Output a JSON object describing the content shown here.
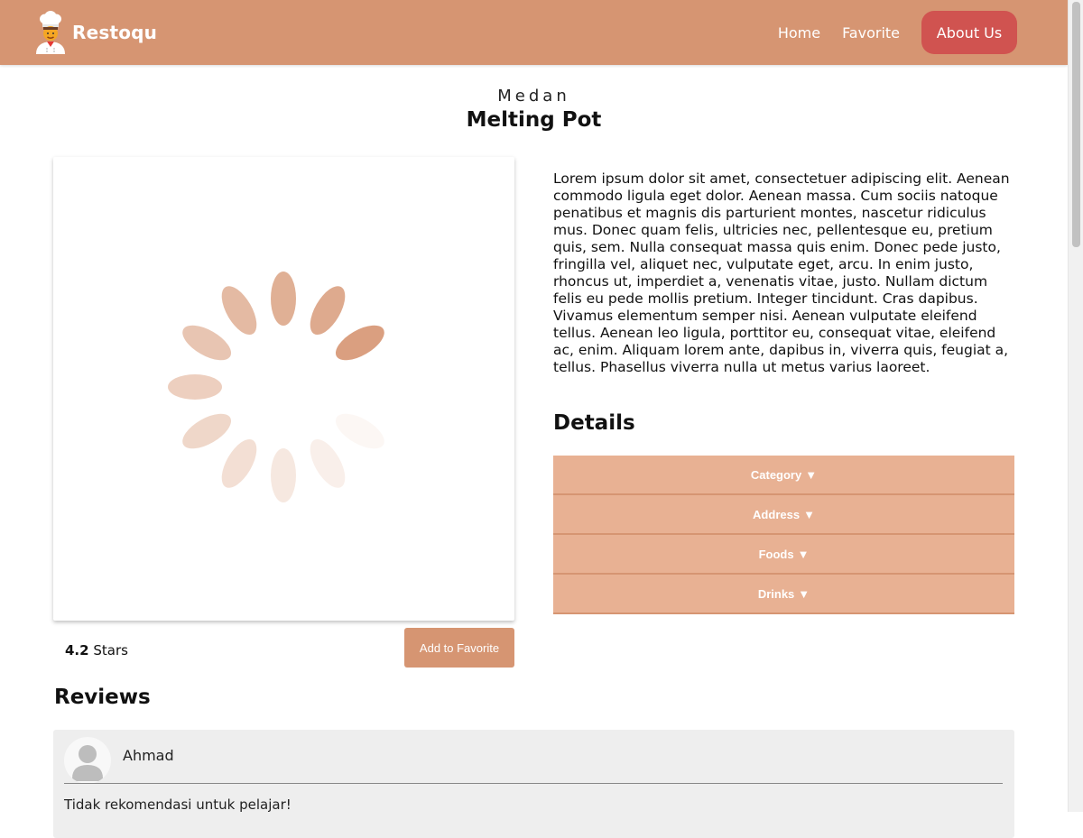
{
  "header": {
    "brand": "Restoqu",
    "nav": {
      "home": "Home",
      "favorite": "Favorite",
      "about": "About Us"
    }
  },
  "restaurant": {
    "city": "Medan",
    "name": "Melting Pot",
    "description": "Lorem ipsum dolor sit amet, consectetuer adipiscing elit. Aenean commodo ligula eget dolor. Aenean massa. Cum sociis natoque penatibus et magnis dis parturient montes, nascetur ridiculus mus. Donec quam felis, ultricies nec, pellentesque eu, pretium quis, sem. Nulla consequat massa quis enim. Donec pede justo, fringilla vel, aliquet nec, vulputate eget, arcu. In enim justo, rhoncus ut, imperdiet a, venenatis vitae, justo. Nullam dictum felis eu pede mollis pretium. Integer tincidunt. Cras dapibus. Vivamus elementum semper nisi. Aenean vulputate eleifend tellus. Aenean leo ligula, porttitor eu, consequat vitae, eleifend ac, enim. Aliquam lorem ante, dapibus in, viverra quis, feugiat a, tellus. Phasellus viverra nulla ut metus varius laoreet.",
    "rating_value": "4.2",
    "rating_label": "Stars",
    "add_favorite_label": "Add to Favorite"
  },
  "details": {
    "title": "Details",
    "sections": [
      {
        "label": "Category",
        "arrow": "▼"
      },
      {
        "label": "Address",
        "arrow": "▼"
      },
      {
        "label": "Foods",
        "arrow": "▼"
      },
      {
        "label": "Drinks",
        "arrow": "▼"
      }
    ]
  },
  "reviews": {
    "title": "Reviews",
    "items": [
      {
        "name": "Ahmad",
        "text": "Tidak rekomendasi untuk pelajar!"
      }
    ]
  },
  "colors": {
    "header_bg": "#d69572",
    "about_button_bg": "#d05350",
    "accordion_bg": "#e8b193",
    "spinner": "#d69572"
  },
  "icons": {
    "logo": "chef-icon",
    "image_placeholder": "loading-spinner-icon",
    "avatar": "user-avatar-icon"
  }
}
